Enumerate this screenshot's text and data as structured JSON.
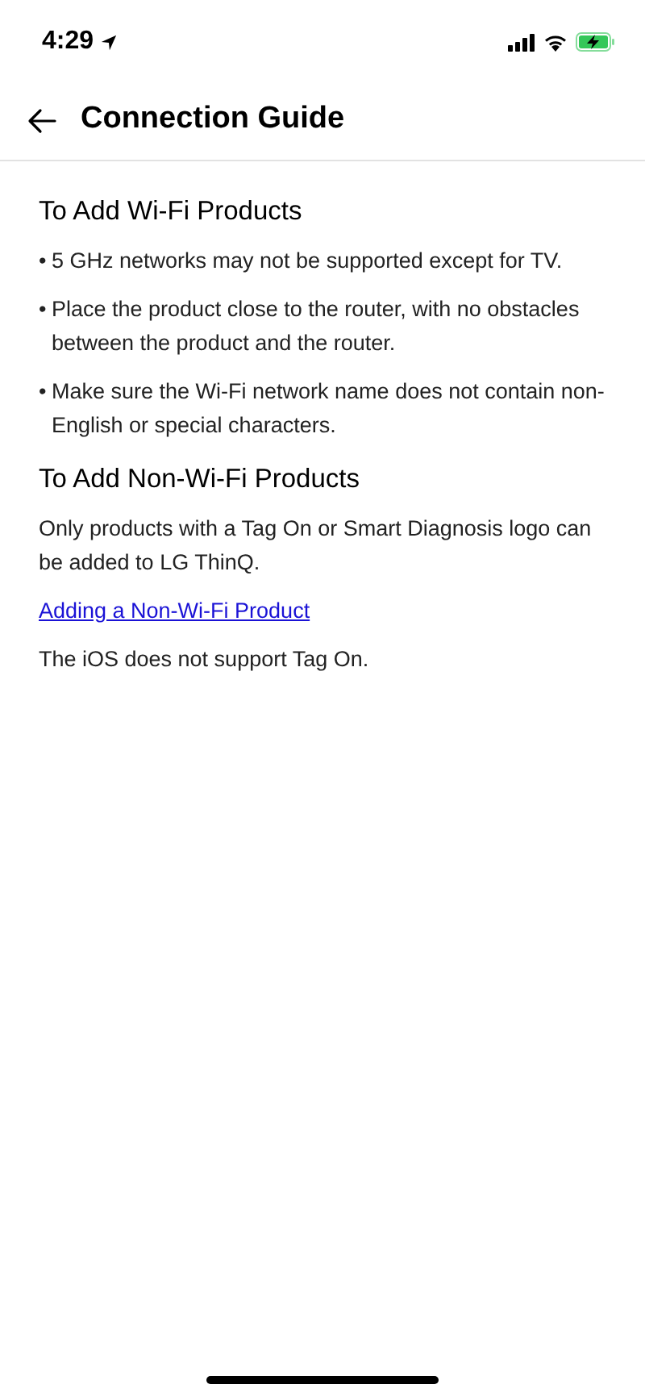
{
  "status_bar": {
    "time": "4:29"
  },
  "header": {
    "title": "Connection Guide"
  },
  "sections": [
    {
      "heading": "To Add Wi-Fi Products",
      "items": [
        {
          "kind": "bullet",
          "marker": "•",
          "text": "5 GHz networks may not be supported except for TV."
        },
        {
          "kind": "bullet",
          "marker": "•",
          "text": "Place the product close to the router, with no obstacles between the product and the router."
        },
        {
          "kind": "bullet",
          "marker": "•",
          "text": "Make sure the Wi-Fi network name does not contain non-English or special characters."
        }
      ]
    },
    {
      "heading": "To Add Non-Wi-Fi Products",
      "items": [
        {
          "kind": "paragraph",
          "text": "Only products with a Tag On or Smart Diagnosis logo can be added to LG ThinQ."
        },
        {
          "kind": "link",
          "text": "Adding a Non-Wi-Fi Product"
        },
        {
          "kind": "paragraph",
          "text": "The iOS does not support Tag On."
        }
      ]
    }
  ]
}
